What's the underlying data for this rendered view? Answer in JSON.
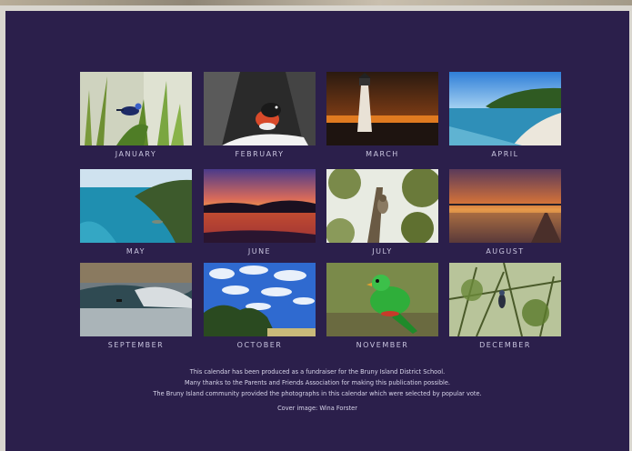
{
  "months": [
    {
      "label": "JANUARY",
      "icon": "blue-wren-photo"
    },
    {
      "label": "FEBRUARY",
      "icon": "robin-photo"
    },
    {
      "label": "MARCH",
      "icon": "lighthouse-photo"
    },
    {
      "label": "APRIL",
      "icon": "beach-photo"
    },
    {
      "label": "MAY",
      "icon": "coastal-cliff-photo"
    },
    {
      "label": "JUNE",
      "icon": "sunset-lake-photo"
    },
    {
      "label": "JULY",
      "icon": "owl-in-tree-photo"
    },
    {
      "label": "AUGUST",
      "icon": "sunset-jetty-photo"
    },
    {
      "label": "SEPTEMBER",
      "icon": "surfer-wave-photo"
    },
    {
      "label": "OCTOBER",
      "icon": "cloudy-sky-photo"
    },
    {
      "label": "NOVEMBER",
      "icon": "green-parrot-photo"
    },
    {
      "label": "DECEMBER",
      "icon": "bird-in-bush-photo"
    }
  ],
  "footer": {
    "line1": "This calendar has been produced as a fundraiser for the Bruny Island District School.",
    "line2": "Many thanks to the Parents and Friends Association for making this publication possible.",
    "line3": "The Bruny Island community provided the photographs in this calendar which were selected by popular vote.",
    "cover": "Cover image: Wina Forster"
  },
  "colors": {
    "page_background": "#2b1f4b",
    "label_text": "#c9c5df"
  }
}
